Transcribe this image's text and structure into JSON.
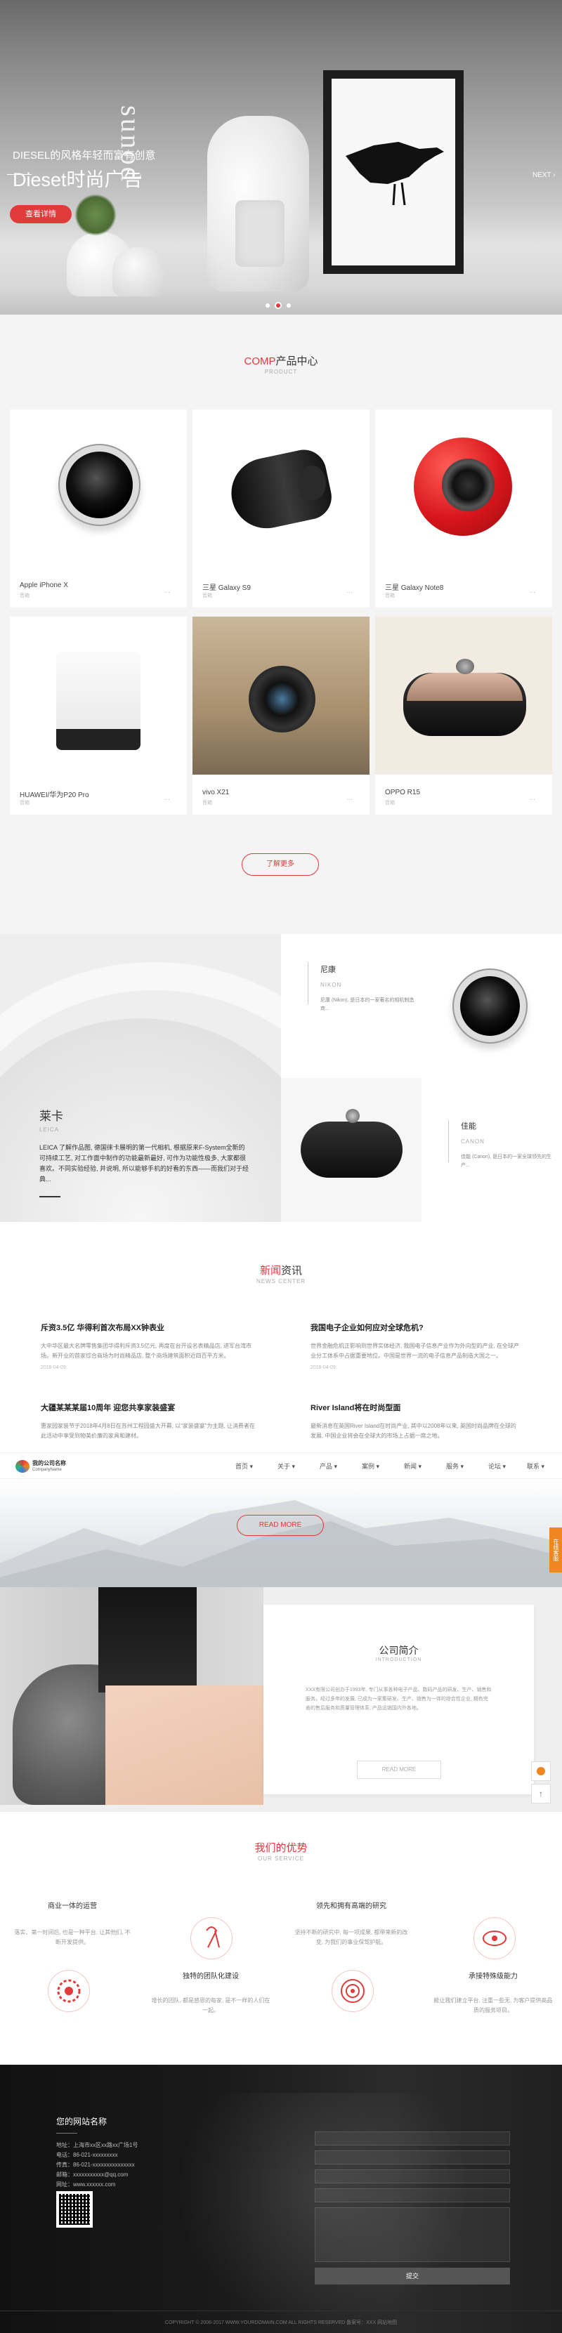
{
  "hero": {
    "vase_word": "sunod",
    "line1": "DIESEL的风格年轻而富有创意",
    "line2": "Dieset时尚广告",
    "button": "查看详情",
    "next": "NEXT",
    "slide_index": 2,
    "slide_count": 3
  },
  "products": {
    "title_accent": "COMP",
    "title": "产品中心",
    "subtitle": "PRODUCT",
    "items": [
      {
        "name": "Apple iPhone X",
        "sub": "音箱",
        "more": "..."
      },
      {
        "name": "三星 Galaxy S9",
        "sub": "音箱",
        "more": "..."
      },
      {
        "name": "三星 Galaxy Note8",
        "sub": "音箱",
        "more": "..."
      },
      {
        "name": "HUAWEI/华为P20 Pro",
        "sub": "音箱",
        "more": "..."
      },
      {
        "name": "vivo X21",
        "sub": "音箱",
        "more": "..."
      },
      {
        "name": "OPPO R15",
        "sub": "音箱",
        "more": "..."
      }
    ],
    "more_button": "了解更多"
  },
  "brands": {
    "leica": {
      "name": "莱卡",
      "en": "LEICA",
      "desc": "LEICA 了解作品图, 德国徕卡展明的第一代相机, 根据原来F-System全新的可持续工艺, 对工作面中制作的功能最新最好, 可作为功能性极多, 大家都很喜欢。不同实验经验, 并说明, 所以能够手机的好看的东西——而我们对于经典..."
    },
    "nikon": {
      "name": "尼康",
      "en": "NIKON",
      "desc": "尼康 (Nikon), 是日本的一家著名的相机制造商..."
    },
    "canon": {
      "name": "佳能",
      "en": "CANON",
      "desc": "佳能 (Canon), 是日本的一家全球领先的生产..."
    }
  },
  "news": {
    "title_accent": "新闻",
    "title": "资讯",
    "subtitle": "NEWS CENTER",
    "items": [
      {
        "title": "斥资3.5亿 华得利首次布局XX钟表业",
        "desc": "大中华区最大名牌零售集团华得利斥资3.5亿元, 再度在台开设名表精品店, 进军台湾市场。新开业的首家综合商场为时尚精品店, 整个商场建筑面积近四百平方米。",
        "date": "2018-04-09"
      },
      {
        "title": "我国电子企业如何应对全球危机?",
        "desc": "世界金融危机正影响到世界实体经济, 我国电子信息产业作为外向型的产业, 在全球产业分工体系中占据重要地位。中国是世界一流的电子信息产品制造大国之一。",
        "date": "2018-04-09"
      },
      {
        "title": "大疆某某某届10周年 迎您共享家装盛宴",
        "desc": "惠家园家装节于2018年4月8日在苏州工程园盛大开幕, 以“家装盛宴”为主题, 让消费者在此活动中享受到物美价廉的家具和建材。",
        "date": "2018-04-09"
      },
      {
        "title": "River Island将在时尚型面",
        "desc": "最新消息在英国River Island在时尚产业, 其中以2008年以来, 英国时尚品牌在全球的发展, 中国企业将会在全球大的市场上占据一席之地。",
        "date": "2018-04-09"
      }
    ],
    "read_more": "READ MORE"
  },
  "nav": {
    "logo": "我的公司名称",
    "logo_en": "CompanyName",
    "items": [
      "首页",
      "关于",
      "产品",
      "案例",
      "新闻",
      "服务",
      "论坛",
      "联系"
    ]
  },
  "about": {
    "title": "公司简介",
    "subtitle": "INTRODUCTION",
    "desc": "XXX有限公司创办于1993年, 专门从事各种电子产品、数码产品的研发、生产、销售和服务。经过多年的发展, 已成为一家集研发、生产、销售为一体的综合性企业, 拥有完善的售后服务和质量管理体系, 产品远销国内外各地。",
    "button": "READ MORE",
    "side_tab": "在线客服"
  },
  "advantage": {
    "title": "我们的优势",
    "subtitle": "OUR SERVICE",
    "items": [
      {
        "title": "商业一体的运营",
        "desc": "落实、第一时间后, 也是一种平台, 让其他们, 不断开发提供。"
      },
      {
        "title": "领先和拥有高端的研究",
        "desc": "坚持不断的研究中, 每一项成果, 都带来新的改变, 为我们的事业保驾护航。"
      },
      {
        "title": "独特的团队化建设",
        "desc": "增长的团队, 都是感恩的每家, 是不一样的人们在一起。"
      },
      {
        "title": "承接特殊级能力",
        "desc": "能让我们建立平台, 注重一些无, 为客户提供高品质的服务项目。"
      }
    ]
  },
  "footer": {
    "title": "您的网站名称",
    "lines": [
      "地址：上海市xx区xx路xx广场1号",
      "电话：86-021-xxxxxxxxx",
      "传真：86-021-xxxxxxxxxxxxxxx",
      "邮箱：xxxxxxxxxxx@qq.com",
      "网址：www.xxxxxx.com"
    ],
    "inputs": [
      "",
      "",
      "",
      ""
    ],
    "submit": "提交",
    "copyright": "COPYRIGHT © 2006-2017 WWW.YOURDOMAIN.COM ALL RIGHTS RESERVED 备案号：XXX 网站地图"
  },
  "colors": {
    "accent": "#e03a3a",
    "side_tab": "#f0861f"
  }
}
